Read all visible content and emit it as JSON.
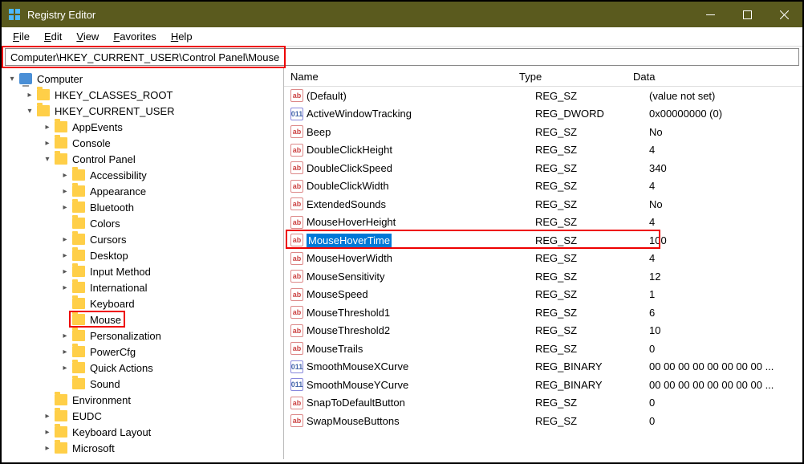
{
  "window": {
    "title": "Registry Editor"
  },
  "menu": {
    "file": "File",
    "edit": "Edit",
    "view": "View",
    "favorites": "Favorites",
    "help": "Help"
  },
  "address": {
    "path": "Computer\\HKEY_CURRENT_USER\\Control Panel\\Mouse"
  },
  "tree": {
    "root": "Computer",
    "items": [
      {
        "label": "HKEY_CLASSES_ROOT",
        "indent": 1,
        "arrow": "right"
      },
      {
        "label": "HKEY_CURRENT_USER",
        "indent": 1,
        "arrow": "down"
      },
      {
        "label": "AppEvents",
        "indent": 2,
        "arrow": "right"
      },
      {
        "label": "Console",
        "indent": 2,
        "arrow": "right"
      },
      {
        "label": "Control Panel",
        "indent": 2,
        "arrow": "down"
      },
      {
        "label": "Accessibility",
        "indent": 3,
        "arrow": "right"
      },
      {
        "label": "Appearance",
        "indent": 3,
        "arrow": "right"
      },
      {
        "label": "Bluetooth",
        "indent": 3,
        "arrow": "right"
      },
      {
        "label": "Colors",
        "indent": 3,
        "arrow": ""
      },
      {
        "label": "Cursors",
        "indent": 3,
        "arrow": "right"
      },
      {
        "label": "Desktop",
        "indent": 3,
        "arrow": "right"
      },
      {
        "label": "Input Method",
        "indent": 3,
        "arrow": "right"
      },
      {
        "label": "International",
        "indent": 3,
        "arrow": "right"
      },
      {
        "label": "Keyboard",
        "indent": 3,
        "arrow": ""
      },
      {
        "label": "Mouse",
        "indent": 3,
        "arrow": "",
        "boxed": true
      },
      {
        "label": "Personalization",
        "indent": 3,
        "arrow": "right"
      },
      {
        "label": "PowerCfg",
        "indent": 3,
        "arrow": "right"
      },
      {
        "label": "Quick Actions",
        "indent": 3,
        "arrow": "right"
      },
      {
        "label": "Sound",
        "indent": 3,
        "arrow": ""
      },
      {
        "label": "Environment",
        "indent": 2,
        "arrow": ""
      },
      {
        "label": "EUDC",
        "indent": 2,
        "arrow": "right"
      },
      {
        "label": "Keyboard Layout",
        "indent": 2,
        "arrow": "right"
      },
      {
        "label": "Microsoft",
        "indent": 2,
        "arrow": "right"
      }
    ]
  },
  "columns": {
    "name": "Name",
    "type": "Type",
    "data": "Data"
  },
  "values": [
    {
      "icon": "sz",
      "name": "(Default)",
      "type": "REG_SZ",
      "data": "(value not set)"
    },
    {
      "icon": "bin",
      "name": "ActiveWindowTracking",
      "type": "REG_DWORD",
      "data": "0x00000000 (0)"
    },
    {
      "icon": "sz",
      "name": "Beep",
      "type": "REG_SZ",
      "data": "No"
    },
    {
      "icon": "sz",
      "name": "DoubleClickHeight",
      "type": "REG_SZ",
      "data": "4"
    },
    {
      "icon": "sz",
      "name": "DoubleClickSpeed",
      "type": "REG_SZ",
      "data": "340"
    },
    {
      "icon": "sz",
      "name": "DoubleClickWidth",
      "type": "REG_SZ",
      "data": "4"
    },
    {
      "icon": "sz",
      "name": "ExtendedSounds",
      "type": "REG_SZ",
      "data": "No"
    },
    {
      "icon": "sz",
      "name": "MouseHoverHeight",
      "type": "REG_SZ",
      "data": "4"
    },
    {
      "icon": "sz",
      "name": "MouseHoverTime",
      "type": "REG_SZ",
      "data": "100",
      "selected": true
    },
    {
      "icon": "sz",
      "name": "MouseHoverWidth",
      "type": "REG_SZ",
      "data": "4"
    },
    {
      "icon": "sz",
      "name": "MouseSensitivity",
      "type": "REG_SZ",
      "data": "12"
    },
    {
      "icon": "sz",
      "name": "MouseSpeed",
      "type": "REG_SZ",
      "data": "1"
    },
    {
      "icon": "sz",
      "name": "MouseThreshold1",
      "type": "REG_SZ",
      "data": "6"
    },
    {
      "icon": "sz",
      "name": "MouseThreshold2",
      "type": "REG_SZ",
      "data": "10"
    },
    {
      "icon": "sz",
      "name": "MouseTrails",
      "type": "REG_SZ",
      "data": "0"
    },
    {
      "icon": "bin",
      "name": "SmoothMouseXCurve",
      "type": "REG_BINARY",
      "data": "00 00 00 00 00 00 00 00 ..."
    },
    {
      "icon": "bin",
      "name": "SmoothMouseYCurve",
      "type": "REG_BINARY",
      "data": "00 00 00 00 00 00 00 00 ..."
    },
    {
      "icon": "sz",
      "name": "SnapToDefaultButton",
      "type": "REG_SZ",
      "data": "0"
    },
    {
      "icon": "sz",
      "name": "SwapMouseButtons",
      "type": "REG_SZ",
      "data": "0"
    }
  ]
}
